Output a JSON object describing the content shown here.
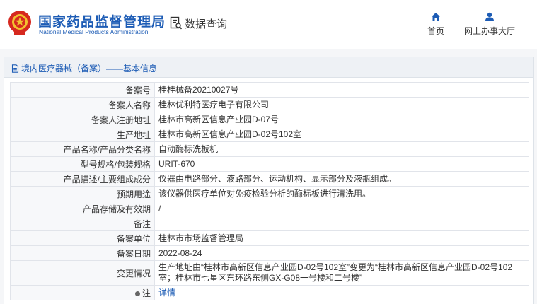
{
  "header": {
    "brand_cn": "国家药品监督管理局",
    "brand_en": "National Medical Products Administration",
    "search_label": "数据查询",
    "nav": [
      {
        "label": "首页",
        "icon": "home-icon"
      },
      {
        "label": "网上办事大厅",
        "icon": "user-icon"
      }
    ]
  },
  "panel": {
    "title": "境内医疗器械（备案）——基本信息",
    "rows": [
      {
        "key": "备案号",
        "value": "桂桂械备20210027号"
      },
      {
        "key": "备案人名称",
        "value": "桂林优利特医疗电子有限公司"
      },
      {
        "key": "备案人注册地址",
        "value": "桂林市高新区信息产业园D-07号"
      },
      {
        "key": "生产地址",
        "value": "桂林市高新区信息产业园D-02号102室"
      },
      {
        "key": "产品名称/产品分类名称",
        "value": "自动酶标洗板机"
      },
      {
        "key": "型号规格/包装规格",
        "value": "URIT-670"
      },
      {
        "key": "产品描述/主要组成成分",
        "value": "仪器由电路部分、液路部分、运动机构、显示部分及液瓶组成。"
      },
      {
        "key": "预期用途",
        "value": "该仪器供医疗单位对免疫检验分析的酶标板进行清洗用。"
      },
      {
        "key": "产品存储及有效期",
        "value": "/"
      },
      {
        "key": "备注",
        "value": ""
      },
      {
        "key": "备案单位",
        "value": "桂林市市场监督管理局"
      },
      {
        "key": "备案日期",
        "value": "2022-08-24"
      },
      {
        "key": "变更情况",
        "value": "生产地址由“桂林市高新区信息产业园D-02号102室”变更为“桂林市高新区信息产业园D-02号102室；桂林市七星区东环路东侧GX-G08一号楼和二号楼”"
      },
      {
        "key": "注",
        "value": "详情"
      }
    ]
  },
  "colors": {
    "brand": "#1d5cb5",
    "emblem": "#d6281f"
  }
}
